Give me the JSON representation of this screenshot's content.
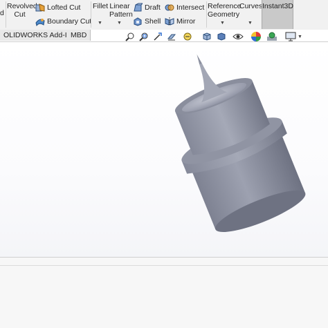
{
  "ribbon": {
    "cut_partial": "d",
    "revolved_cut": [
      "Revolved",
      "Cut"
    ],
    "lofted_cut": "Lofted Cut",
    "boundary_cut": "Boundary Cut",
    "fillet": "Fillet",
    "linear_pattern": [
      "Linear",
      "Pattern"
    ],
    "draft": "Draft",
    "shell": "Shell",
    "intersect": "Intersect",
    "mirror": "Mirror",
    "reference_geometry": [
      "Reference",
      "Geometry"
    ],
    "curves": "Curves",
    "instant3d": "Instant3D"
  },
  "tabs": [
    {
      "label": "OLIDWORKS Add-Ins"
    },
    {
      "label": "MBD"
    }
  ],
  "model": {
    "body_color": "#8c90a0",
    "rim_color": "#7b7f8f"
  }
}
